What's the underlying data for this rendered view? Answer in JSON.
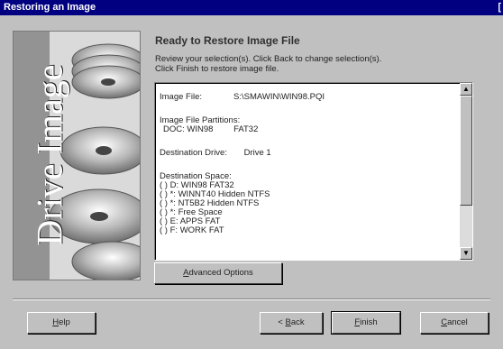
{
  "window": {
    "title": "Restoring an Image",
    "edge_glyph": "["
  },
  "banner": {
    "brand": "Drive Image"
  },
  "heading": "Ready to Restore Image File",
  "instructions": [
    "Review your selection(s). Click Back to change selection(s).",
    "Click Finish to restore image file."
  ],
  "summary": {
    "image_file_label": "Image File:",
    "image_file_value": "S:\\SMAWIN\\WIN98.PQI",
    "partitions_label": "Image File Partitions:",
    "partition_name": "DOC: WIN98",
    "partition_fs": "FAT32",
    "destination_drive_label": "Destination Drive:",
    "destination_drive_value": "Drive 1",
    "destination_space_label": "Destination Space:",
    "destination_space_items": [
      "( ) D: WIN98 FAT32",
      "( ) *: WINNT40 Hidden NTFS",
      "( ) *: NT5B2 Hidden NTFS",
      "( ) *: Free Space",
      "( ) E: APPS FAT",
      "( ) F: WORK FAT"
    ]
  },
  "scroll": {
    "up_glyph": "▲",
    "down_glyph": "▼"
  },
  "buttons": {
    "advanced": {
      "prefix": "",
      "underline": "A",
      "rest": "dvanced Options"
    },
    "help": {
      "prefix": "",
      "underline": "H",
      "rest": "elp"
    },
    "back": {
      "prefix": "< ",
      "underline": "B",
      "rest": "ack"
    },
    "finish": {
      "prefix": "",
      "underline": "F",
      "rest": "inish"
    },
    "cancel": {
      "prefix": "",
      "underline": "C",
      "rest": "ancel"
    }
  }
}
